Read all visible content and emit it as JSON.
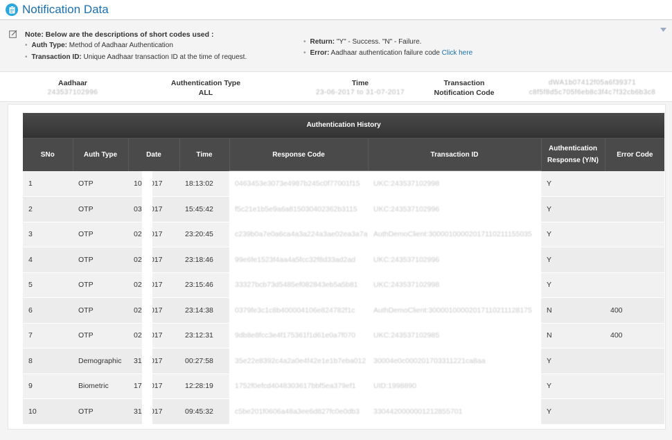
{
  "header": {
    "title": "Notification Data",
    "icon": "clipboard-icon"
  },
  "notes": {
    "heading": "Note: Below are the descriptions of short codes used :",
    "auth_type_label": "Auth Type:",
    "auth_type_desc": "Method of Aadhaar Authentication",
    "txn_id_label": "Transaction ID:",
    "txn_id_desc": "Unique Aadhaar transaction ID at the time of request.",
    "return_label": "Return:",
    "return_desc": "\"Y\" - Success. \"N\" - Failure.",
    "error_label": "Error:",
    "error_desc": "Aadhaar authentication failure code",
    "error_link": "Click here"
  },
  "summary": {
    "aadhaar_label": "Aadhaar",
    "aadhaar_value": "243537102996",
    "auth_type_label": "Authentication Type",
    "auth_type_value": "ALL",
    "time_label": "Time",
    "time_value": "23-06-2017 to 31-07-2017",
    "txn_label_1": "Transaction",
    "txn_label_2": "Notification Code",
    "txn_value_1": "dWA1b07412f05a6f39371",
    "txn_value_2": "c8f5f8d5c705f6eb8c3f4c7f32cb6b3c8"
  },
  "table": {
    "caption": "Authentication History",
    "columns": [
      "SNo",
      "Auth Type",
      "Date",
      "Time",
      "Response Code",
      "Transaction ID",
      "Authentication Response (Y/N)",
      "Error Code"
    ],
    "rows": [
      {
        "sno": "1",
        "type": "OTP",
        "date": "10- 2017",
        "time": "18:13:02",
        "resp": "0463453e3073e4987b245c0f77001f15",
        "txn": "UKC:243537102998",
        "yn": "Y",
        "err": ""
      },
      {
        "sno": "2",
        "type": "OTP",
        "date": "03- 2017",
        "time": "15:45:42",
        "resp": "f5c21e1b5e9a6a815030402362b3115",
        "txn": "UKC:243537102996",
        "yn": "Y",
        "err": ""
      },
      {
        "sno": "3",
        "type": "OTP",
        "date": "02- 2017",
        "time": "23:20:45",
        "resp": "c239b0a7e0a6ca4a3a224a3ae02ea3a7ad",
        "txn": "AuthDemoClient:30000100002017110211155035",
        "yn": "Y",
        "err": ""
      },
      {
        "sno": "4",
        "type": "OTP",
        "date": "02- 2017",
        "time": "23:18:46",
        "resp": "99e6fe1523f4aa4a5fcc32f8d33ad2ad",
        "txn": "UKC:243537102996",
        "yn": "Y",
        "err": ""
      },
      {
        "sno": "5",
        "type": "OTP",
        "date": "02- 2017",
        "time": "23:15:46",
        "resp": "33327bcb73d5485ef082843eb5a5b81",
        "txn": "UKC:243537102998",
        "yn": "Y",
        "err": ""
      },
      {
        "sno": "6",
        "type": "OTP",
        "date": "02- 2017",
        "time": "23:14:38",
        "resp": "0379fe3c1c8b400004106e824782f1c",
        "txn": "AuthDemoClient:30000100002017110211128175",
        "yn": "N",
        "err": "400"
      },
      {
        "sno": "7",
        "type": "OTP",
        "date": "02- 2017",
        "time": "23:12:31",
        "resp": "9db8e8fcc3e4f175361f1d61e0a7f070",
        "txn": "UKC:243537102985",
        "yn": "N",
        "err": "400"
      },
      {
        "sno": "8",
        "type": "Demographic",
        "date": "31- 2017",
        "time": "00:27:58",
        "resp": "35e22e8392c4a2a0e4f42e1e1b7eba012",
        "txn": "30004e0c000201703311221ca8aa",
        "yn": "Y",
        "err": ""
      },
      {
        "sno": "9",
        "type": "Biometric",
        "date": "17- 2017",
        "time": "12:28:19",
        "resp": "1752f0efcd4048303617bbf5ea379ef1",
        "txn": "UID:1998890",
        "yn": "Y",
        "err": ""
      },
      {
        "sno": "10",
        "type": "OTP",
        "date": "31- 2017",
        "time": "09:45:32",
        "resp": "c5be201f0606a48a3ee6d827fc0e0db3",
        "txn": "3304420000001212855701",
        "yn": "Y",
        "err": ""
      }
    ]
  }
}
